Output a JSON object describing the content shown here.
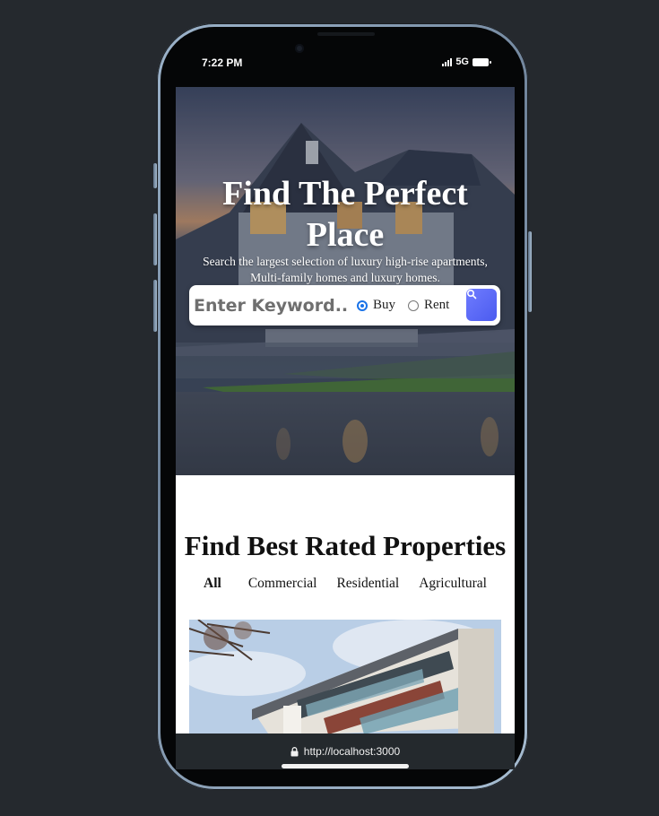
{
  "status_bar": {
    "time": "7:22 PM",
    "network": "5G"
  },
  "hero": {
    "title": "Find The Perfect Place",
    "subtitle": "Search the largest selection of luxury high-rise apartments, Multi-family homes and luxury homes."
  },
  "search": {
    "placeholder": "Enter Keyword...",
    "options": [
      {
        "label": "Buy",
        "checked": true
      },
      {
        "label": "Rent",
        "checked": false
      }
    ],
    "button_icon": "search-icon"
  },
  "properties": {
    "title": "Find Best Rated Properties",
    "filters": [
      "All",
      "Commercial",
      "Residential",
      "Agricultural"
    ],
    "active_filter": "All"
  },
  "browser": {
    "url": "http://localhost:3000",
    "lock_icon": "lock-icon"
  },
  "colors": {
    "accent": "#5b6af5",
    "radio_checked": "#1a73e8",
    "background": "#25292e"
  }
}
